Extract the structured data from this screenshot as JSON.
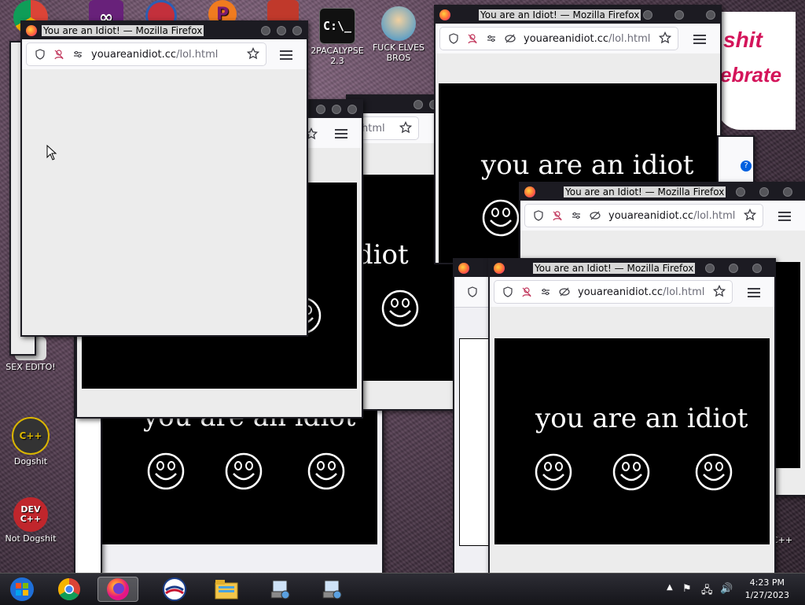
{
  "desktop": {
    "icons": [
      {
        "id": "c4-icon",
        "label": "",
        "glyph": "C:\\_"
      },
      {
        "id": "2pacalypse",
        "label": "2PACALYPSE 2.3"
      },
      {
        "id": "fuck-elves",
        "label": "FUCK ELVES BROS"
      },
      {
        "id": "sex-editor",
        "label": "SEX EDITO!"
      },
      {
        "id": "dogshit",
        "label": "Dogshit"
      },
      {
        "id": "not-dogshit",
        "label": "Not Dogshit"
      },
      {
        "id": "cpp-right",
        "label": "C++"
      }
    ],
    "dev_cpp_glyph": "DEV\nC++",
    "banner_line1": "shit",
    "banner_line2": "ebrate"
  },
  "browser": {
    "title": "You are an Idiot! — Mozilla Firefox",
    "url_domain": "youareanidiot.cc",
    "url_path": "/lol.html",
    "url_partial": "html",
    "page_text": "you are an idiot"
  },
  "taskbar": {
    "time": "4:23 PM",
    "date": "1/27/2023",
    "pinned": [
      "start-icon",
      "chrome-icon",
      "firefox-icon",
      "obama-icon",
      "file-explorer-icon",
      "installer-icon",
      "installer2-icon"
    ],
    "active": "firefox-icon"
  },
  "colors": {
    "titlebar": "#1c1b22",
    "page_black": "#000000",
    "accent": "#d4145a"
  }
}
